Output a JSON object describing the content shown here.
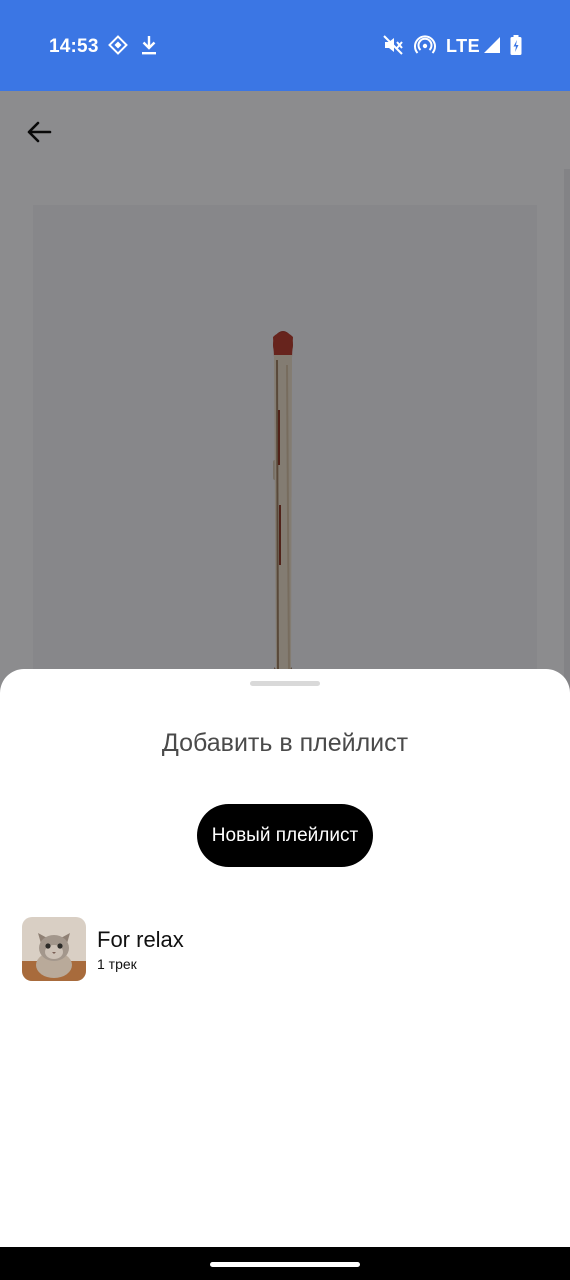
{
  "status_bar": {
    "time": "14:53",
    "network": "LTE",
    "icons": [
      "app-notification-icon",
      "download-icon",
      "mute-icon",
      "hotspot-icon",
      "signal-icon",
      "battery-charging-icon"
    ],
    "background": "#3b76e4"
  },
  "page": {
    "back_icon": "arrow-left-icon",
    "cover_art": "matchstick-image"
  },
  "sheet": {
    "title": "Добавить в плейлист",
    "new_playlist_label": "Новый плейлист",
    "playlists": [
      {
        "name": "For relax",
        "count": "1 трек",
        "thumbnail": "cat-image"
      }
    ]
  }
}
